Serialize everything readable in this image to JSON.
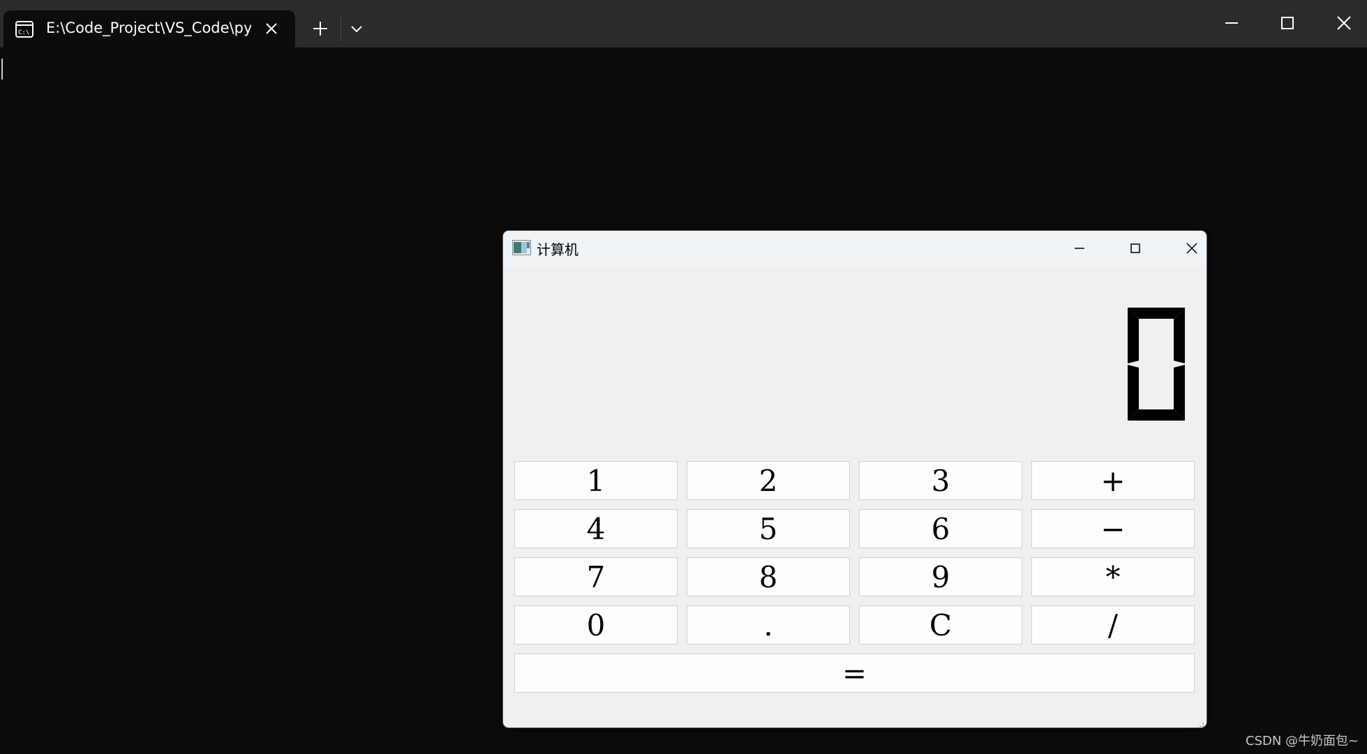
{
  "terminal": {
    "tab_title": "E:\\Code_Project\\VS_Code\\pyc",
    "tab_icon": "terminal-icon"
  },
  "calculator": {
    "title": "计算机",
    "display_value": 0,
    "buttons": {
      "one": "1",
      "two": "2",
      "three": "3",
      "plus": "+",
      "four": "4",
      "five": "5",
      "six": "6",
      "minus": "−",
      "seven": "7",
      "eight": "8",
      "nine": "9",
      "multiply": "*",
      "zero": "0",
      "dot": ".",
      "clear": "C",
      "divide": "/",
      "equals": "="
    }
  },
  "watermark": "CSDN @牛奶面包~",
  "colors": {
    "terminal_bg": "#0c0c0c",
    "titlebar_bg": "#2b2b2b",
    "window_bg": "#f0f0f0",
    "button_bg": "#fdfdfd"
  }
}
